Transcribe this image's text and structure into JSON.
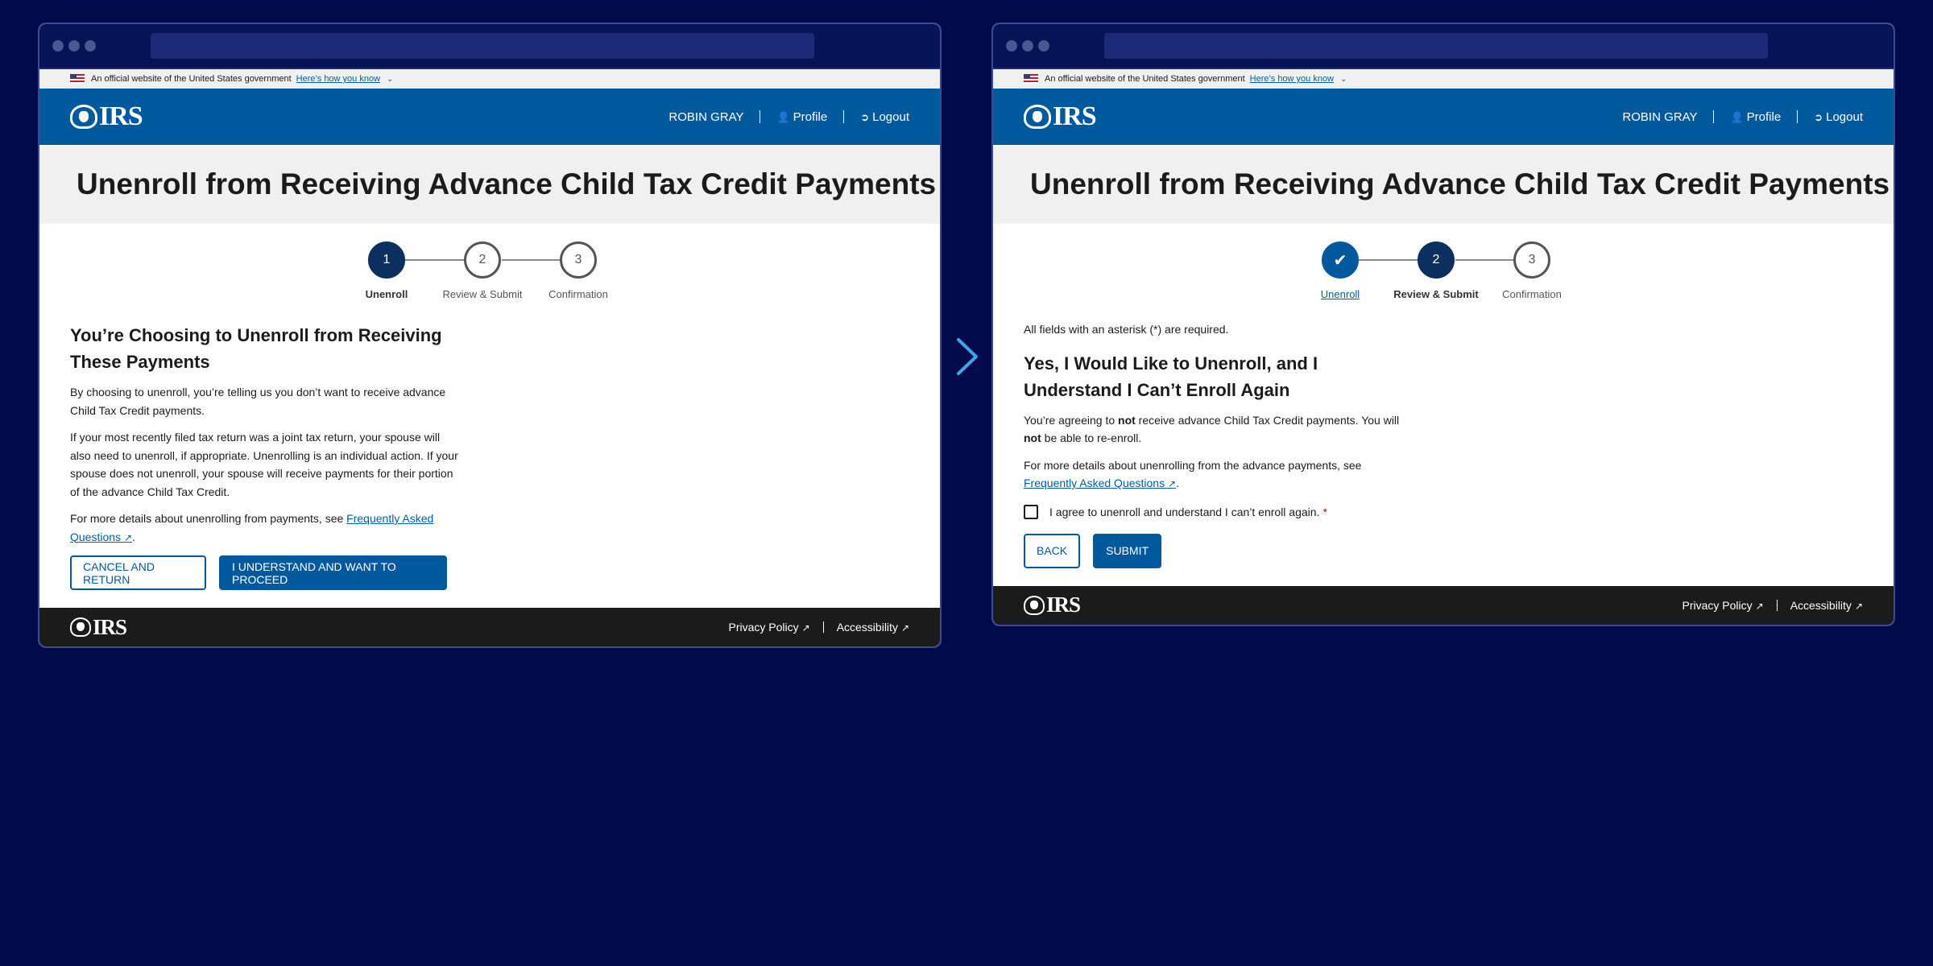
{
  "gov_banner": {
    "text": "An official website of the United States government",
    "link": "Here’s how you know"
  },
  "header": {
    "logo": "IRS",
    "user_name": "ROBIN GRAY",
    "profile": "Profile",
    "logout": "Logout"
  },
  "page_title": "Unenroll from Receiving Advance Child Tax Credit Payments",
  "steps": {
    "step1_number": "1",
    "step1_label": "Unenroll",
    "step2_number": "2",
    "step2_label": "Review & Submit",
    "step3_number": "3",
    "step3_label": "Confirmation"
  },
  "left": {
    "heading": "You’re Choosing to Unenroll from Receiving These Payments",
    "p1": "By choosing to unenroll, you’re telling us you don’t want to receive advance Child Tax Credit payments.",
    "p2": "If your most recently filed tax return was a joint tax return, your spouse will also need to unenroll, if appropriate. Unenrolling is an individual action. If your spouse does not unenroll, your spouse will receive payments for their portion of the advance Child Tax Credit.",
    "p3_prefix": "For more details about unenrolling from payments, see ",
    "faq_link": "Frequently Asked Questions",
    "period": ".",
    "cancel_button": "CANCEL AND RETURN",
    "proceed_button": "I UNDERSTAND AND WANT TO PROCEED"
  },
  "right": {
    "required_note": "All fields with an asterisk (*) are required.",
    "heading": "Yes, I Would Like to Unenroll, and I Understand I Can’t Enroll Again",
    "p1_a": "You’re agreeing to ",
    "p1_b": "not",
    "p1_c": " receive advance Child Tax Credit payments. You will ",
    "p1_d": "not",
    "p1_e": " be able to re-enroll.",
    "p2_prefix": "For more details about unenrolling from the advance payments, see ",
    "faq_link": "Frequently Asked Questions",
    "period": ".",
    "checkbox_label": "I agree to unenroll and understand I can’t enroll again.",
    "asterisk": "*",
    "back_button": "BACK",
    "submit_button": "SUBMIT"
  },
  "footer": {
    "logo": "IRS",
    "privacy": "Privacy Policy",
    "accessibility": "Accessibility"
  },
  "colors": {
    "background": "#020b4a",
    "irs_blue": "#00599c",
    "step_dark": "#0b2f5f",
    "arrow": "#3aa6e8"
  }
}
